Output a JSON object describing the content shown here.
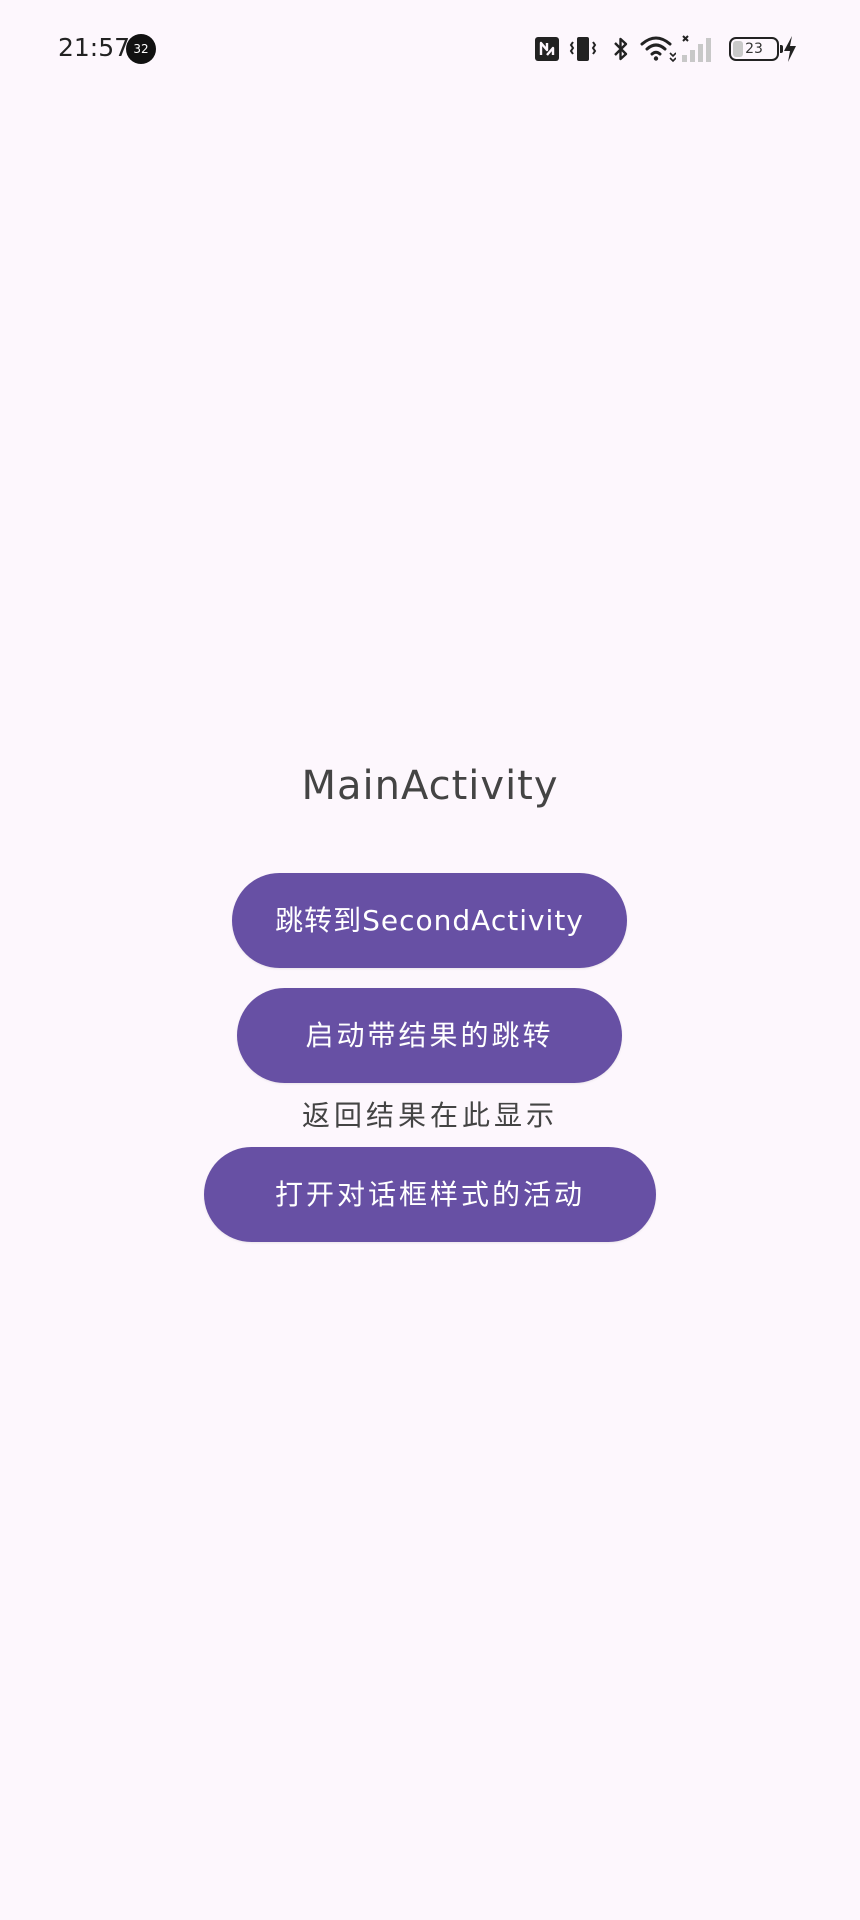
{
  "status_bar": {
    "time": "21:57",
    "notification_count": "32",
    "battery_level": "23",
    "battery_fraction": 0.23,
    "icons": [
      "nfc-icon",
      "vibrate-icon",
      "bluetooth-icon",
      "wifi-icon",
      "cellular-no-signal-icon",
      "battery-icon",
      "charging-icon"
    ]
  },
  "main": {
    "title": "MainActivity",
    "buttons": {
      "jump_second": "跳转到SecondActivity",
      "start_for_result": "启动带结果的跳转",
      "open_dialog_activity": "打开对话框样式的活动"
    },
    "result_text": "返回结果在此显示"
  },
  "colors": {
    "background": "#FDF7FD",
    "accent": "#6750A4",
    "button_text": "#FFFFFF"
  }
}
